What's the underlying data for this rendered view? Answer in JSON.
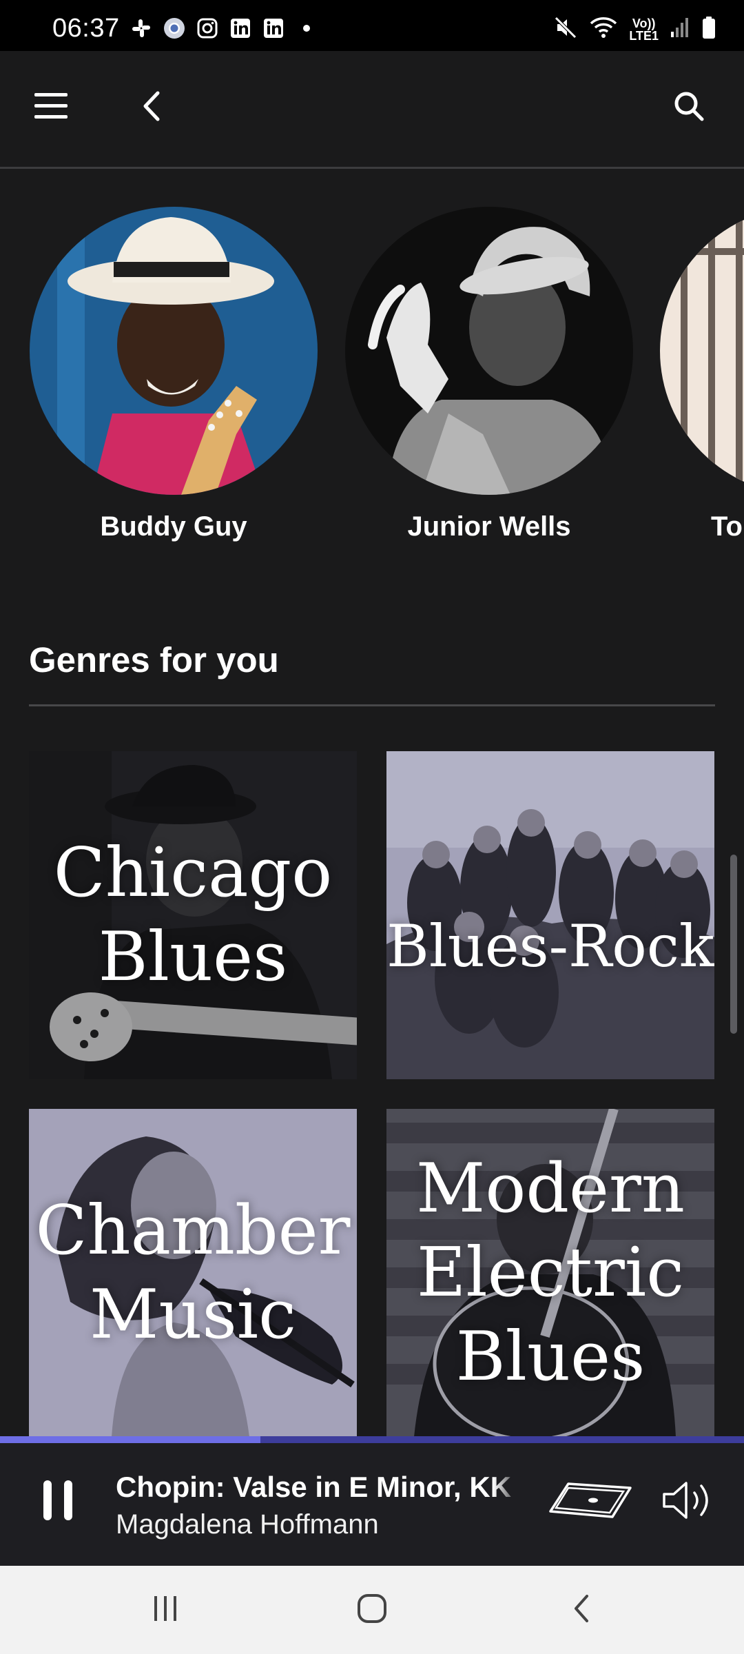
{
  "status_bar": {
    "time": "06:37",
    "left_icons": [
      "slack-icon",
      "chrome-icon",
      "instagram-icon",
      "linkedin-icon",
      "linkedin-icon",
      "dot-icon"
    ],
    "right_icons": [
      "mute-icon",
      "wifi-icon",
      "lte-icon",
      "signal-icon",
      "battery-icon"
    ],
    "volte_label": "Vo))",
    "lte_label": "LTE1"
  },
  "app_bar": {
    "menu_icon": "hamburger-menu-icon",
    "back_icon": "back-chevron-icon",
    "search_icon": "search-icon"
  },
  "artists": [
    {
      "name": "Buddy Guy"
    },
    {
      "name": "Junior Wells"
    },
    {
      "name": "To"
    }
  ],
  "genres_section": {
    "title": "Genres for you",
    "tiles": [
      {
        "label_lines": [
          "Chicago",
          "Blues"
        ]
      },
      {
        "label_lines": [
          "Blues-Rock"
        ]
      },
      {
        "label_lines": [
          "Chamber",
          "Music"
        ]
      },
      {
        "label_lines": [
          "Modern",
          "Electric",
          "Blues"
        ]
      }
    ]
  },
  "player": {
    "title": "Chopin: Valse in E Minor, KK IV",
    "artist": "Magdalena Hoffmann",
    "progress": 0.35,
    "play_state_icon": "pause-icon",
    "cast_icon": "device-icon",
    "volume_icon": "volume-icon"
  },
  "nav_bar": {
    "icons": [
      "recents-icon",
      "home-icon",
      "back-icon"
    ]
  },
  "colors": {
    "background": "#1a1a1b",
    "accent": "#6e6ee6",
    "progress_track": "#3d3d9c"
  }
}
